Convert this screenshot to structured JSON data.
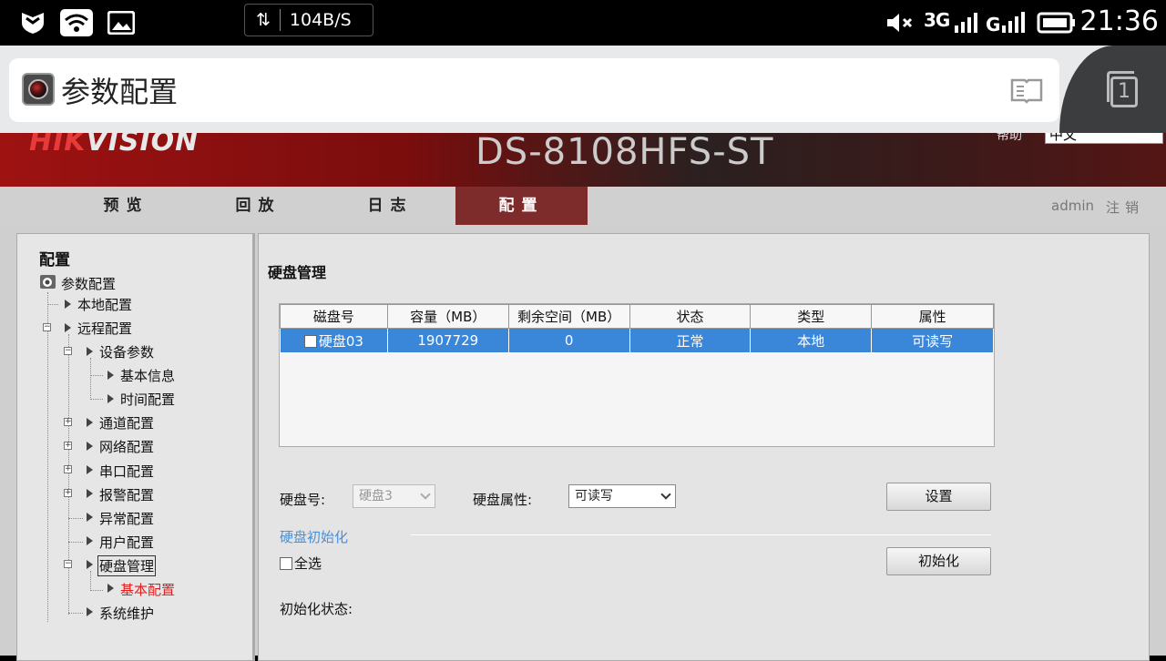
{
  "status_bar": {
    "net_speed": "104B/S",
    "network": "3G",
    "time": "21:36",
    "tab_count": "1"
  },
  "browser": {
    "page_title": "参数配置"
  },
  "header": {
    "logo_red": "HIK",
    "logo_white": "VISION",
    "model": "DS-8108HFS-ST",
    "help": "帮助",
    "language": "中文"
  },
  "nav": {
    "tabs": [
      {
        "label": "预览"
      },
      {
        "label": "回放"
      },
      {
        "label": "日志"
      },
      {
        "label": "配置"
      }
    ],
    "user": "admin",
    "logout": "注销"
  },
  "sidebar": {
    "title": "配置",
    "items": [
      {
        "label": "参数配置"
      },
      {
        "label": "本地配置"
      },
      {
        "label": "远程配置"
      },
      {
        "label": "设备参数"
      },
      {
        "label": "基本信息"
      },
      {
        "label": "时间配置"
      },
      {
        "label": "通道配置"
      },
      {
        "label": "网络配置"
      },
      {
        "label": "串口配置"
      },
      {
        "label": "报警配置"
      },
      {
        "label": "异常配置"
      },
      {
        "label": "用户配置"
      },
      {
        "label": "硬盘管理"
      },
      {
        "label": "基本配置"
      },
      {
        "label": "系统维护"
      }
    ]
  },
  "main": {
    "title": "硬盘管理",
    "table": {
      "headers": [
        "磁盘号",
        "容量（MB）",
        "剩余空间（MB）",
        "状态",
        "类型",
        "属性"
      ],
      "rows": [
        [
          "硬盘03",
          "1907729",
          "0",
          "正常",
          "本地",
          "可读写"
        ]
      ]
    },
    "disk_label": "硬盘号:",
    "disk_value": "硬盘3",
    "attr_label": "硬盘属性:",
    "attr_value": "可读写",
    "set_button": "设置",
    "init_section": "硬盘初始化",
    "select_all": "全选",
    "init_button": "初始化",
    "init_status_label": "初始化状态:"
  },
  "colors": {
    "nav_active": "#7e2b2b",
    "row_selected": "#3a86d9",
    "tree_active": "#e02020",
    "section_title": "#4a90d6"
  }
}
